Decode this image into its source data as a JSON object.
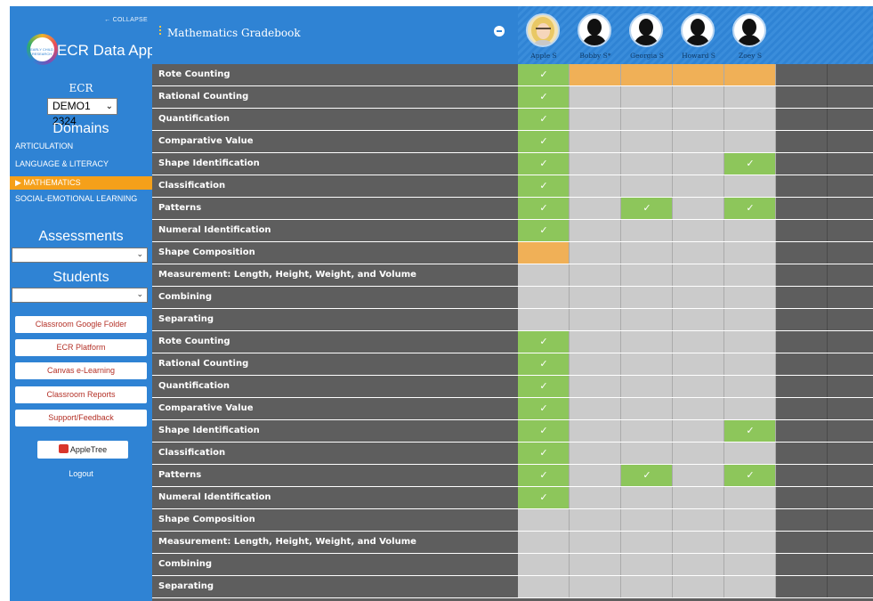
{
  "sidebar": {
    "collapse_label": "← COLLAPSE",
    "logo_text": "EARLY CHILD RESEARCH",
    "app_title": "ECR Data App",
    "ecr_label": "ECR",
    "ecr_select_value": "DEMO1 2324",
    "domains_heading": "Domains",
    "domains": [
      {
        "label": "ARTICULATION",
        "active": false
      },
      {
        "label": "LANGUAGE & LITERACY",
        "active": false
      },
      {
        "label": "▶ MATHEMATICS",
        "active": true
      },
      {
        "label": "SOCIAL-EMOTIONAL LEARNING",
        "active": false
      }
    ],
    "assessments_heading": "Assessments",
    "assessments_value": "",
    "students_heading": "Students",
    "students_value": "",
    "links": [
      "Classroom Google Folder",
      "ECR Platform",
      "Canvas e-Learning",
      "Classroom Reports",
      "Support/Feedback"
    ],
    "appletree_label": "AppleTree",
    "logout_label": "Logout"
  },
  "header": {
    "title": "Mathematics Gradebook"
  },
  "students": [
    {
      "name": "Apple S",
      "photo": true
    },
    {
      "name": "Bobby S*",
      "photo": false
    },
    {
      "name": "Georgia S",
      "photo": false
    },
    {
      "name": "Howard S",
      "photo": false
    },
    {
      "name": "Zoey S",
      "photo": false
    }
  ],
  "check_glyph": "✓",
  "colors": {
    "sidebar_blue": "#2f83d4",
    "active_orange": "#f5a01a",
    "check_green": "#8dc65b",
    "flag_orange": "#f0b057",
    "empty_gray": "#cbcbcb",
    "row_dark": "#5e5e5e"
  },
  "rows": [
    {
      "label": "Rote Counting",
      "cells": [
        "green",
        "orange",
        "orange",
        "orange",
        "orange"
      ]
    },
    {
      "label": "Rational Counting",
      "cells": [
        "green",
        "empty",
        "empty",
        "empty",
        "empty"
      ]
    },
    {
      "label": "Quantification",
      "cells": [
        "green",
        "empty",
        "empty",
        "empty",
        "empty"
      ]
    },
    {
      "label": "Comparative Value",
      "cells": [
        "green",
        "empty",
        "empty",
        "empty",
        "empty"
      ]
    },
    {
      "label": "Shape Identification",
      "cells": [
        "green",
        "empty",
        "empty",
        "empty",
        "green"
      ]
    },
    {
      "label": "Classification",
      "cells": [
        "green",
        "empty",
        "empty",
        "empty",
        "empty"
      ]
    },
    {
      "label": "Patterns",
      "cells": [
        "green",
        "empty",
        "green",
        "empty",
        "green"
      ]
    },
    {
      "label": "Numeral Identification",
      "cells": [
        "green",
        "empty",
        "empty",
        "empty",
        "empty"
      ]
    },
    {
      "label": "Shape Composition",
      "cells": [
        "orange",
        "empty",
        "empty",
        "empty",
        "empty"
      ]
    },
    {
      "label": "Measurement: Length, Height, Weight, and Volume",
      "cells": [
        "empty",
        "empty",
        "empty",
        "empty",
        "empty"
      ]
    },
    {
      "label": "Combining",
      "cells": [
        "empty",
        "empty",
        "empty",
        "empty",
        "empty"
      ]
    },
    {
      "label": "Separating",
      "cells": [
        "empty",
        "empty",
        "empty",
        "empty",
        "empty"
      ]
    },
    {
      "label": "Rote Counting",
      "cells": [
        "green",
        "empty",
        "empty",
        "empty",
        "empty"
      ]
    },
    {
      "label": "Rational Counting",
      "cells": [
        "green",
        "empty",
        "empty",
        "empty",
        "empty"
      ]
    },
    {
      "label": "Quantification",
      "cells": [
        "green",
        "empty",
        "empty",
        "empty",
        "empty"
      ]
    },
    {
      "label": "Comparative Value",
      "cells": [
        "green",
        "empty",
        "empty",
        "empty",
        "empty"
      ]
    },
    {
      "label": "Shape Identification",
      "cells": [
        "green",
        "empty",
        "empty",
        "empty",
        "green"
      ]
    },
    {
      "label": "Classification",
      "cells": [
        "green",
        "empty",
        "empty",
        "empty",
        "empty"
      ]
    },
    {
      "label": "Patterns",
      "cells": [
        "green",
        "empty",
        "green",
        "empty",
        "green"
      ]
    },
    {
      "label": "Numeral Identification",
      "cells": [
        "green",
        "empty",
        "empty",
        "empty",
        "empty"
      ]
    },
    {
      "label": "Shape Composition",
      "cells": [
        "empty",
        "empty",
        "empty",
        "empty",
        "empty"
      ]
    },
    {
      "label": "Measurement: Length, Height, Weight, and Volume",
      "cells": [
        "empty",
        "empty",
        "empty",
        "empty",
        "empty"
      ]
    },
    {
      "label": "Combining",
      "cells": [
        "empty",
        "empty",
        "empty",
        "empty",
        "empty"
      ]
    },
    {
      "label": "Separating",
      "cells": [
        "empty",
        "empty",
        "empty",
        "empty",
        "empty"
      ]
    }
  ]
}
